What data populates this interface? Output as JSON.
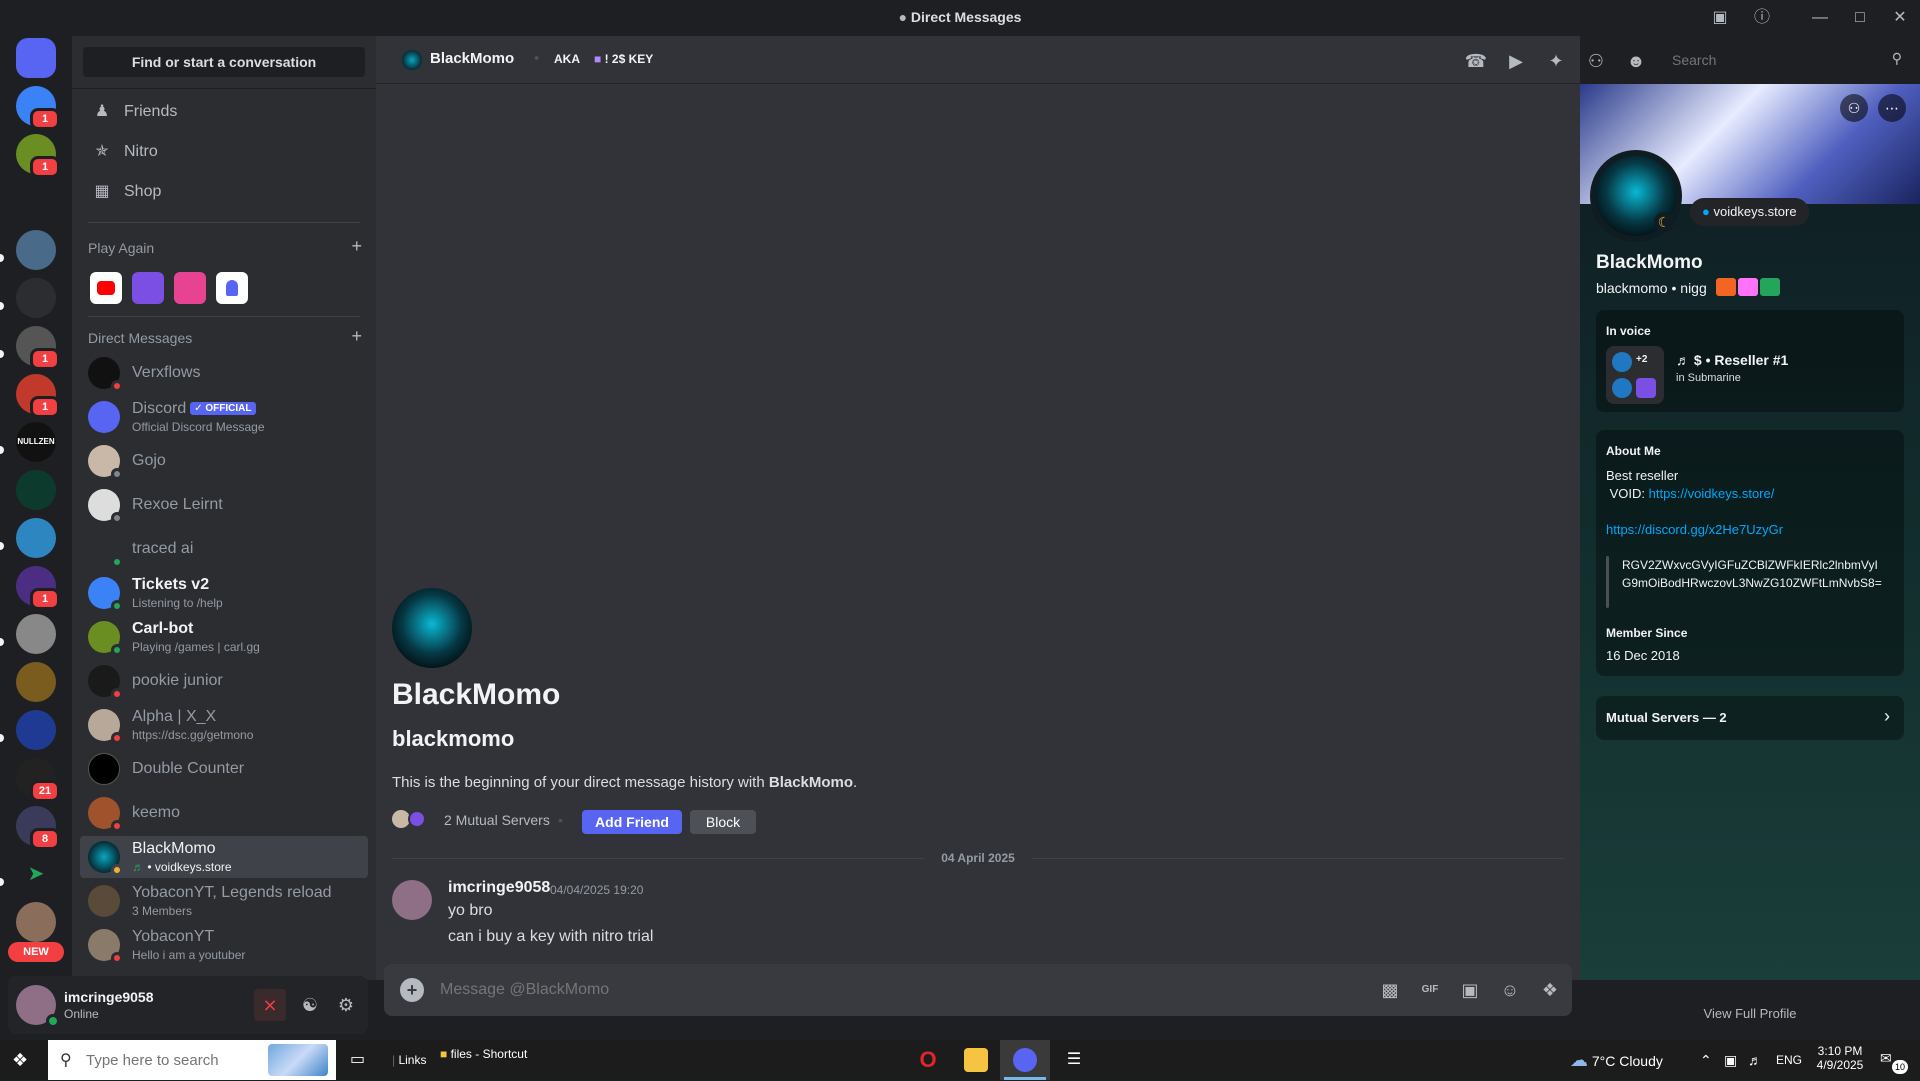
{
  "window": {
    "title": "Direct Messages"
  },
  "sidebar": {
    "find_label": "Find or start a conversation",
    "nav": [
      {
        "label": "Friends",
        "icon": "friends-icon"
      },
      {
        "label": "Nitro",
        "icon": "nitro-icon"
      },
      {
        "label": "Shop",
        "icon": "shop-icon"
      }
    ],
    "play_again_label": "Play Again",
    "dm_label": "Direct Messages",
    "dms": [
      {
        "name": "Verxflows",
        "sub": ""
      },
      {
        "name": "Discord",
        "badge": "✓ OFFICIAL",
        "sub": "Official Discord Message"
      },
      {
        "name": "Gojo",
        "sub": ""
      },
      {
        "name": "Rexoe Leirnt",
        "sub": ""
      },
      {
        "name": "traced ai",
        "sub": ""
      },
      {
        "name": "Tickets v2",
        "sub": "Listening to /help"
      },
      {
        "name": "Carl-bot",
        "sub": "Playing /games | carl.gg"
      },
      {
        "name": "pookie junior",
        "sub": ""
      },
      {
        "name": "Alpha | X_X",
        "sub": "https://dsc.gg/getmono"
      },
      {
        "name": "Double Counter",
        "sub": ""
      },
      {
        "name": "keemo",
        "sub": ""
      },
      {
        "name": "BlackMomo",
        "sub": "voidkeys.store"
      },
      {
        "name": "YobaconYT, Legends reload",
        "sub": "3 Members"
      },
      {
        "name": "YobaconYT",
        "sub": "Hello i am a youtuber"
      }
    ]
  },
  "rail": {
    "badges": [
      "1",
      "1",
      "1",
      "1",
      "1",
      "21",
      "8"
    ],
    "new_label": "NEW",
    "nullzen_label": "NULLZEN"
  },
  "user": {
    "name": "imcringe9058",
    "status": "Online"
  },
  "chat": {
    "header_name": "BlackMomo",
    "header_aka": "AKA",
    "header_tag": "! 2$ KEY",
    "search_placeholder": "Search",
    "intro_name": "BlackMomo",
    "intro_username": "blackmomo",
    "intro_text_prefix": "This is the beginning of your direct message history with ",
    "intro_text_name": "BlackMomo",
    "intro_text_suffix": ".",
    "mutual_servers": "2 Mutual Servers",
    "add_friend": "Add Friend",
    "block": "Block",
    "date_divider": "04 April 2025",
    "message": {
      "author": "imcringe9058",
      "timestamp": "04/04/2025 19:20",
      "lines": [
        "yo bro",
        "can i buy a key with nitro trial"
      ]
    },
    "composer_placeholder": "Message @BlackMomo"
  },
  "profile": {
    "server_tag": "voidkeys.store",
    "display_name": "BlackMomo",
    "username": "blackmomo",
    "pronouns": "nigg",
    "in_voice_label": "In voice",
    "voice_plus": "+2",
    "voice_channel": "$ • Reseller #1",
    "voice_server": "in Submarine",
    "about_label": "About Me",
    "about_line1": "Best reseller",
    "about_line2_prefix": " VOID: ",
    "about_link1": "https://voidkeys.store/",
    "about_link2": "https://discord.gg/x2He7UzyGr",
    "quote": "RGV2ZWxvcGVyIGFuZCBlZWFkIERlc2lnbmVyIG9mOiBodHRwczovL3NwZG10ZWFtLmNvbS8=",
    "member_since_label": "Member Since",
    "member_since": "16 Dec 2018",
    "mutual_label": "Mutual Servers — 2",
    "view_full": "View Full Profile"
  },
  "taskbar": {
    "search_placeholder": "Type here to search",
    "links_label": "Links",
    "files_label": "files - Shortcut",
    "weather": "7°C  Cloudy",
    "lang": "ENG",
    "time": "3:10 PM",
    "date": "4/9/2025",
    "notif_count": "10"
  },
  "colors": {
    "blurple": "#5865f2",
    "online": "#23a55a",
    "dnd": "#f23f42",
    "link": "#00a8fc"
  }
}
